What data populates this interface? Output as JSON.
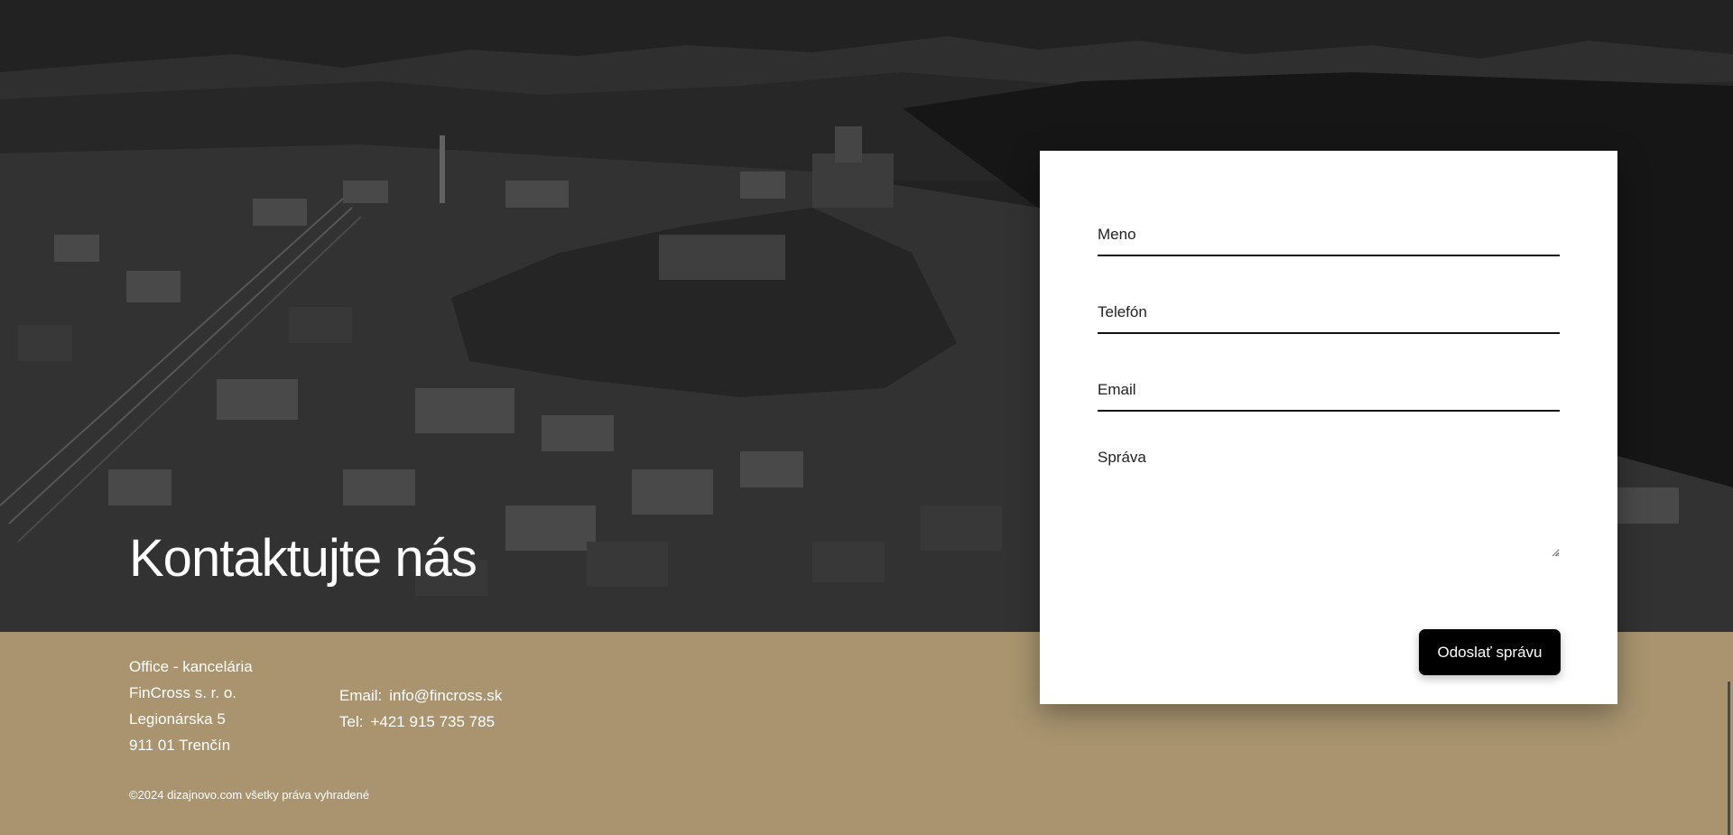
{
  "hero": {
    "title": "Kontaktujte nás",
    "image_desc": "aerial-city-castle-background"
  },
  "form": {
    "name_placeholder": "Meno",
    "phone_placeholder": "Telefón",
    "email_placeholder": "Email",
    "message_placeholder": "Správa",
    "submit_label": "Odoslať správu"
  },
  "footer": {
    "office_lines": [
      "Office - kancelária",
      "FinCross s. r. o.",
      "Legionárska 5",
      "911 01 Trenčín"
    ],
    "email_label": "Email:",
    "email_value": "info@fincross.sk",
    "phone_label": "Tel:",
    "phone_value": "+421 915 735 785",
    "copyright": "©2024 dizajnovo.com všetky práva vyhradené"
  },
  "colors": {
    "footer_bg": "#a9946f",
    "button_bg": "#000000",
    "card_bg": "#ffffff"
  }
}
